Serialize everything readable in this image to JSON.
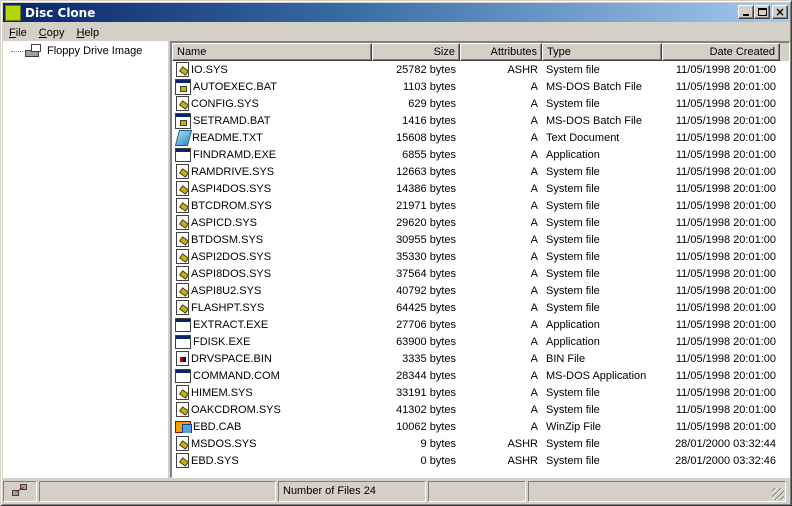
{
  "window": {
    "title": "Disc Clone",
    "accent": "#0a246a"
  },
  "menu": [
    {
      "label": "File",
      "mnemonic": "F",
      "rest": "ile"
    },
    {
      "label": "Copy",
      "mnemonic": "C",
      "rest": "opy"
    },
    {
      "label": "Help",
      "mnemonic": "H",
      "rest": "elp"
    }
  ],
  "tree": {
    "items": [
      {
        "label": "Floppy Drive Image",
        "icon": "drive-icon"
      }
    ]
  },
  "list": {
    "columns": [
      "Name",
      "Size",
      "Attributes",
      "Type",
      "Date Created"
    ],
    "rows": [
      {
        "icon": "sys",
        "name": "IO.SYS",
        "size": "25782 bytes",
        "attr": "ASHR",
        "type": "System file",
        "date": "11/05/1998 20:01:00"
      },
      {
        "icon": "bat",
        "name": "AUTOEXEC.BAT",
        "size": "1103 bytes",
        "attr": "A",
        "type": "MS-DOS Batch File",
        "date": "11/05/1998 20:01:00"
      },
      {
        "icon": "sys",
        "name": "CONFIG.SYS",
        "size": "629 bytes",
        "attr": "A",
        "type": "System file",
        "date": "11/05/1998 20:01:00"
      },
      {
        "icon": "bat",
        "name": "SETRAMD.BAT",
        "size": "1416 bytes",
        "attr": "A",
        "type": "MS-DOS Batch File",
        "date": "11/05/1998 20:01:00"
      },
      {
        "icon": "txt",
        "name": "README.TXT",
        "size": "15608 bytes",
        "attr": "A",
        "type": "Text Document",
        "date": "11/05/1998 20:01:00"
      },
      {
        "icon": "exe",
        "name": "FINDRAMD.EXE",
        "size": "6855 bytes",
        "attr": "A",
        "type": "Application",
        "date": "11/05/1998 20:01:00"
      },
      {
        "icon": "sys",
        "name": "RAMDRIVE.SYS",
        "size": "12663 bytes",
        "attr": "A",
        "type": "System file",
        "date": "11/05/1998 20:01:00"
      },
      {
        "icon": "sys",
        "name": "ASPI4DOS.SYS",
        "size": "14386 bytes",
        "attr": "A",
        "type": "System file",
        "date": "11/05/1998 20:01:00"
      },
      {
        "icon": "sys",
        "name": "BTCDROM.SYS",
        "size": "21971 bytes",
        "attr": "A",
        "type": "System file",
        "date": "11/05/1998 20:01:00"
      },
      {
        "icon": "sys",
        "name": "ASPICD.SYS",
        "size": "29620 bytes",
        "attr": "A",
        "type": "System file",
        "date": "11/05/1998 20:01:00"
      },
      {
        "icon": "sys",
        "name": "BTDOSM.SYS",
        "size": "30955 bytes",
        "attr": "A",
        "type": "System file",
        "date": "11/05/1998 20:01:00"
      },
      {
        "icon": "sys",
        "name": "ASPI2DOS.SYS",
        "size": "35330 bytes",
        "attr": "A",
        "type": "System file",
        "date": "11/05/1998 20:01:00"
      },
      {
        "icon": "sys",
        "name": "ASPI8DOS.SYS",
        "size": "37564 bytes",
        "attr": "A",
        "type": "System file",
        "date": "11/05/1998 20:01:00"
      },
      {
        "icon": "sys",
        "name": "ASPI8U2.SYS",
        "size": "40792 bytes",
        "attr": "A",
        "type": "System file",
        "date": "11/05/1998 20:01:00"
      },
      {
        "icon": "sys",
        "name": "FLASHPT.SYS",
        "size": "64425 bytes",
        "attr": "A",
        "type": "System file",
        "date": "11/05/1998 20:01:00"
      },
      {
        "icon": "exe",
        "name": "EXTRACT.EXE",
        "size": "27706 bytes",
        "attr": "A",
        "type": "Application",
        "date": "11/05/1998 20:01:00"
      },
      {
        "icon": "exe",
        "name": "FDISK.EXE",
        "size": "63900 bytes",
        "attr": "A",
        "type": "Application",
        "date": "11/05/1998 20:01:00"
      },
      {
        "icon": "bin",
        "name": "DRVSPACE.BIN",
        "size": "3335 bytes",
        "attr": "A",
        "type": "BIN File",
        "date": "11/05/1998 20:01:00"
      },
      {
        "icon": "exe",
        "name": "COMMAND.COM",
        "size": "28344 bytes",
        "attr": "A",
        "type": "MS-DOS Application",
        "date": "11/05/1998 20:01:00"
      },
      {
        "icon": "sys",
        "name": "HIMEM.SYS",
        "size": "33191 bytes",
        "attr": "A",
        "type": "System file",
        "date": "11/05/1998 20:01:00"
      },
      {
        "icon": "sys",
        "name": "OAKCDROM.SYS",
        "size": "41302 bytes",
        "attr": "A",
        "type": "System file",
        "date": "11/05/1998 20:01:00"
      },
      {
        "icon": "cab",
        "name": "EBD.CAB",
        "size": "10062 bytes",
        "attr": "A",
        "type": "WinZip File",
        "date": "11/05/1998 20:01:00"
      },
      {
        "icon": "sys",
        "name": "MSDOS.SYS",
        "size": "9 bytes",
        "attr": "ASHR",
        "type": "System file",
        "date": "28/01/2000 03:32:44"
      },
      {
        "icon": "sys",
        "name": "EBD.SYS",
        "size": "0 bytes",
        "attr": "ASHR",
        "type": "System file",
        "date": "28/01/2000 03:32:46"
      }
    ]
  },
  "status": {
    "count_text": "Number of Files 24"
  }
}
